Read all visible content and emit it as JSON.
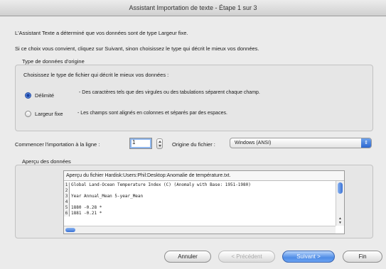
{
  "window": {
    "title": "Assistant Importation de texte - Étape 1 sur 3"
  },
  "intro": {
    "line1": "L'Assistant Texte a déterminé que vos données sont de type Largeur fixe.",
    "line2": "Si ce choix vous convient, cliquez sur Suivant, sinon choisissez le type qui décrit le mieux vos données."
  },
  "source_group": {
    "legend": "Type de données d'origine",
    "prompt": "Choisissez le type de fichier qui décrit le mieux vos données :",
    "options": [
      {
        "label": "Délimité",
        "description": "- Des caractères tels que des virgules ou des tabulations séparent chaque champ.",
        "selected": true
      },
      {
        "label": "Largeur fixe",
        "description": "- Les champs sont alignés en colonnes et séparés par des espaces.",
        "selected": false
      }
    ]
  },
  "start_row": {
    "label": "Commencer l'importation à la ligne :",
    "value": "1"
  },
  "file_origin": {
    "label": "Origine du fichier :",
    "value": "Windows (ANSI)"
  },
  "preview": {
    "legend": "Aperçu des données",
    "title": "Aperçu du fichier Hardisk:Users:Phil:Desktop:Anomalie de température.txt.",
    "lines": [
      {
        "num": "1",
        "text": "Global Land-Ocean Temperature Index (C) (Anomaly with Base: 1951-1980)"
      },
      {
        "num": "2",
        "text": ""
      },
      {
        "num": "3",
        "text": "Year  Annual_Mean 5-year_Mean"
      },
      {
        "num": "4",
        "text": ""
      },
      {
        "num": "5",
        "text": "1880     -0.28        *"
      },
      {
        "num": "6",
        "text": "1881     -0.21        *"
      }
    ]
  },
  "buttons": {
    "cancel": "Annuler",
    "previous": "< Précédent",
    "next": "Suivant >",
    "finish": "Fin"
  },
  "colors": {
    "accent": "#3a72d6",
    "window_bg": "#ebebeb"
  }
}
